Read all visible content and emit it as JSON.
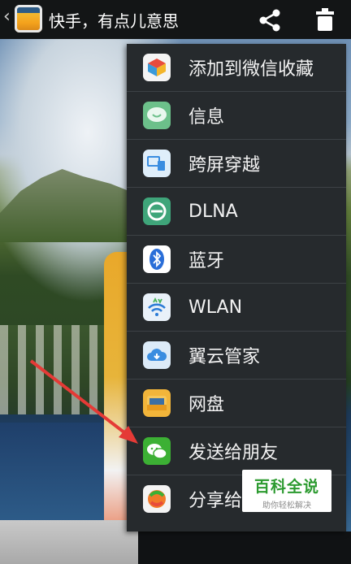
{
  "topbar": {
    "title": "快手，有点儿意思",
    "back_icon": "‹"
  },
  "menu": {
    "items": [
      {
        "label": "添加到微信收藏",
        "icon": "wechat-favorite-icon"
      },
      {
        "label": "信息",
        "icon": "message-icon"
      },
      {
        "label": "跨屏穿越",
        "icon": "cross-screen-icon"
      },
      {
        "label": "DLNA",
        "icon": "dlna-icon"
      },
      {
        "label": "蓝牙",
        "icon": "bluetooth-icon"
      },
      {
        "label": "WLAN",
        "icon": "wlan-icon"
      },
      {
        "label": "翼云管家",
        "icon": "cloud-manager-icon"
      },
      {
        "label": "网盘",
        "icon": "net-disk-icon"
      },
      {
        "label": "发送给朋友",
        "icon": "wechat-icon"
      },
      {
        "label": "分享给",
        "icon": "share-app-icon"
      }
    ]
  },
  "watermark": {
    "title": "百科全说",
    "subtitle": "助你轻松解决"
  },
  "colors": {
    "menu_bg": "#262a2d",
    "divider": "#3d4246",
    "topbar_bg": "#131516",
    "watermark_green": "#2b9a2f",
    "arrow_red": "#e53a36"
  }
}
